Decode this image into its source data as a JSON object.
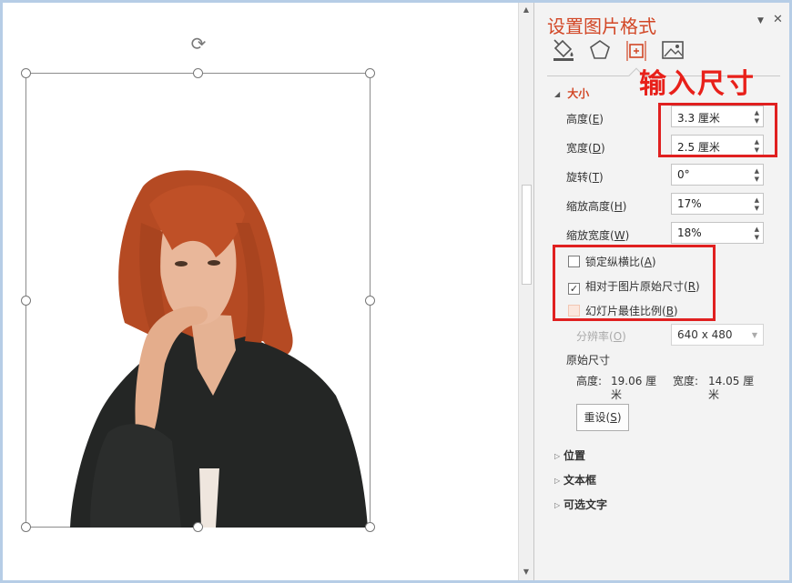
{
  "pane": {
    "title": "设置图片格式",
    "menu_icon": "triangle-down-icon",
    "close_icon": "close-icon",
    "tabs": [
      "fill-line-icon",
      "effects-pentagon-icon",
      "size-properties-icon",
      "picture-icon"
    ],
    "annotation": "输入尺寸",
    "size_section": {
      "heading": "大小",
      "height_label": "高度(",
      "height_key": "E",
      "height_value": "3.3 厘米",
      "width_label": "宽度(",
      "width_key": "D",
      "width_value": "2.5 厘米",
      "rotation_label": "旋转(",
      "rotation_key": "T",
      "rotation_value": "0°",
      "scale_h_label": "缩放高度(",
      "scale_h_key": "H",
      "scale_h_value": "17%",
      "scale_w_label": "缩放宽度(",
      "scale_w_key": "W",
      "scale_w_value": "18%",
      "lock_ratio": {
        "label": "锁定纵横比(",
        "key": "A",
        "checked": false
      },
      "relative_original": {
        "label": "相对于图片原始尺寸(",
        "key": "R",
        "checked": true
      },
      "best_slide": {
        "label": "幻灯片最佳比例(",
        "key": "B",
        "checked": false,
        "disabled": true
      },
      "resolution_label": "分辨率(",
      "resolution_key": "O",
      "resolution_value": "640 x 480",
      "original_size_heading": "原始尺寸",
      "orig_height_label": "高度:",
      "orig_height_value": "19.06 厘",
      "orig_height_value2": "米",
      "orig_width_label": "宽度:",
      "orig_width_value": "14.05 厘",
      "orig_width_value2": "米",
      "reset_label": "重设(",
      "reset_key": "S"
    },
    "collapsed_sections": [
      "位置",
      "文本框",
      "可选文字"
    ]
  },
  "colors": {
    "accent": "#d24726",
    "annotation_red": "#e02020",
    "frame_blue": "#b6cde6"
  }
}
